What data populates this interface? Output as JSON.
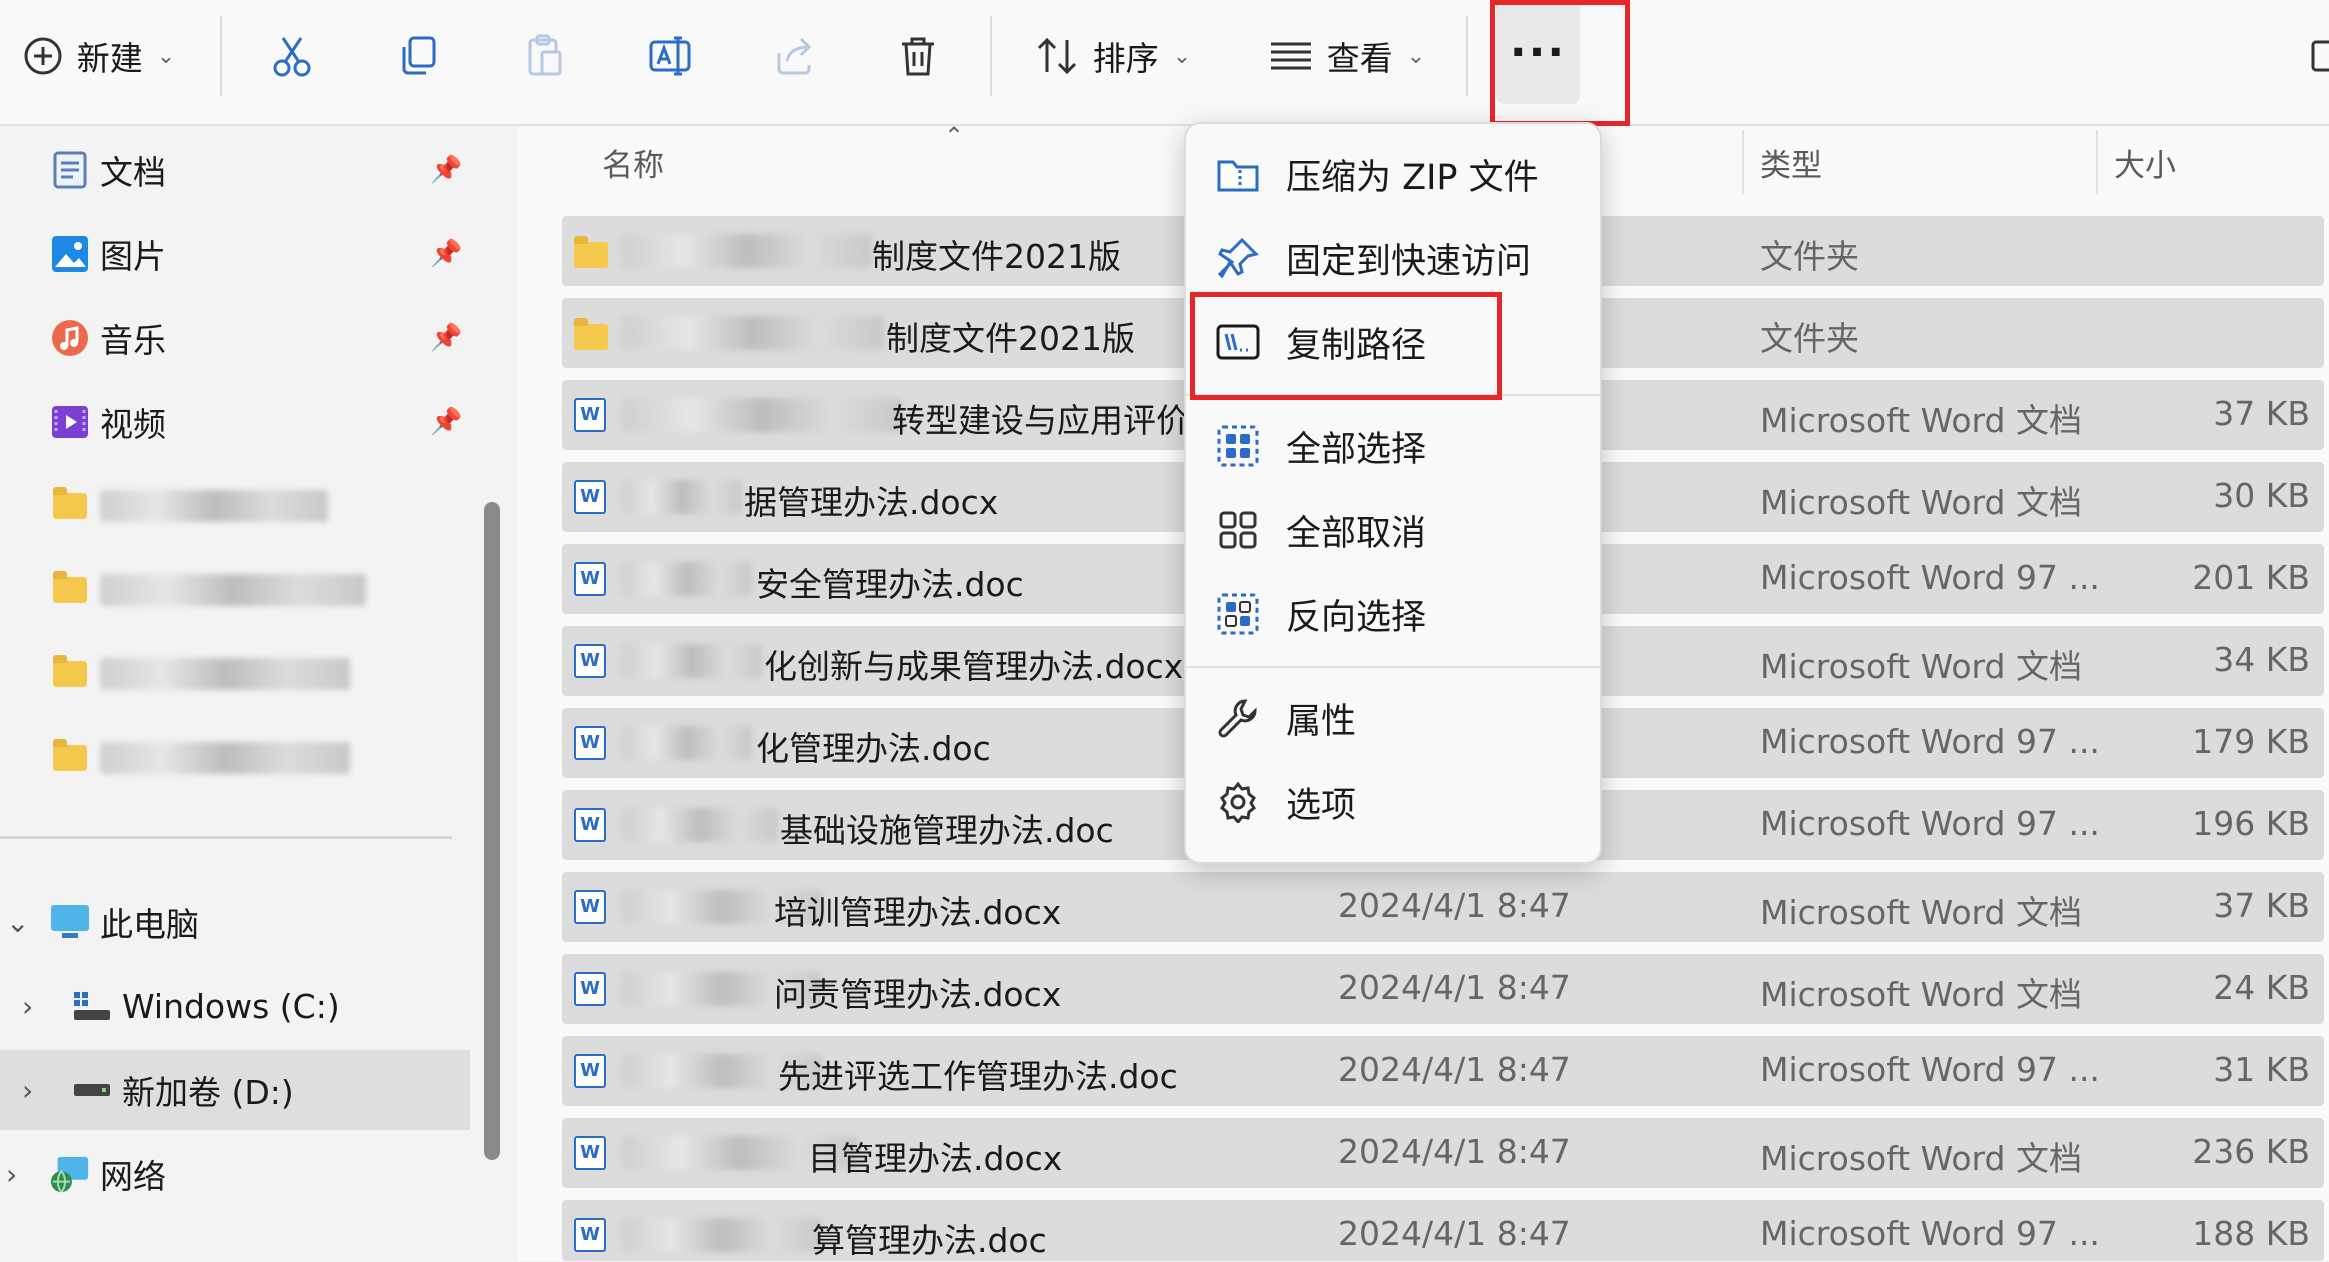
{
  "toolbar": {
    "new_label": "新建",
    "sort_label": "排序",
    "view_label": "查看",
    "more_label": "..."
  },
  "sidebar": {
    "quick": [
      {
        "label": "文档",
        "icon": "documents-icon"
      },
      {
        "label": "图片",
        "icon": "pictures-icon"
      },
      {
        "label": "音乐",
        "icon": "music-icon"
      },
      {
        "label": "视频",
        "icon": "videos-icon"
      }
    ],
    "this_pc": "此电脑",
    "drive_c": "Windows (C:)",
    "drive_d": "新加卷 (D:)",
    "network": "网络"
  },
  "columns": {
    "name": "名称",
    "type": "类型",
    "size": "大小"
  },
  "files": [
    {
      "name": "制度文件2021版",
      "date": "",
      "type": "文件夹",
      "size": "",
      "kind": "folder"
    },
    {
      "name": "制度文件2021版",
      "date": "",
      "type": "文件夹",
      "size": "",
      "kind": "folder"
    },
    {
      "name": "转型建设与应用评价办法",
      "date": "",
      "type": "Microsoft Word 文档",
      "size": "37 KB",
      "kind": "word"
    },
    {
      "name": "据管理办法.docx",
      "date": "",
      "type": "Microsoft Word 文档",
      "size": "30 KB",
      "kind": "word"
    },
    {
      "name": "安全管理办法.doc",
      "date": "",
      "type": "Microsoft Word 97 ...",
      "size": "201 KB",
      "kind": "word"
    },
    {
      "name": "化创新与成果管理办法.docx",
      "date": "",
      "type": "Microsoft Word 文档",
      "size": "34 KB",
      "kind": "word"
    },
    {
      "name": "化管理办法.doc",
      "date": "",
      "type": "Microsoft Word 97 ...",
      "size": "179 KB",
      "kind": "word"
    },
    {
      "name": "基础设施管理办法.doc",
      "date": "",
      "type": "Microsoft Word 97 ...",
      "size": "196 KB",
      "kind": "word"
    },
    {
      "name": "培训管理办法.docx",
      "date": "2024/4/1 8:47",
      "type": "Microsoft Word 文档",
      "size": "37 KB",
      "kind": "word"
    },
    {
      "name": "问责管理办法.docx",
      "date": "2024/4/1 8:47",
      "type": "Microsoft Word 文档",
      "size": "24 KB",
      "kind": "word"
    },
    {
      "name": "先进评选工作管理办法.doc",
      "date": "2024/4/1 8:47",
      "type": "Microsoft Word 97 ...",
      "size": "31 KB",
      "kind": "word"
    },
    {
      "name": "目管理办法.docx",
      "date": "2024/4/1 8:47",
      "type": "Microsoft Word 文档",
      "size": "236 KB",
      "kind": "word"
    },
    {
      "name": "算管理办法.doc",
      "date": "2024/4/1 8:47",
      "type": "Microsoft Word 97 ...",
      "size": "188 KB",
      "kind": "word"
    }
  ],
  "menu": {
    "zip": "压缩为 ZIP 文件",
    "pin": "固定到快速访问",
    "copy_path": "复制路径",
    "select_all": "全部选择",
    "select_none": "全部取消",
    "invert": "反向选择",
    "properties": "属性",
    "options": "选项"
  },
  "colors": {
    "highlight_box": "#e8262a",
    "selected_row": "#dcdcdc",
    "accent": "#2b6cc4"
  }
}
